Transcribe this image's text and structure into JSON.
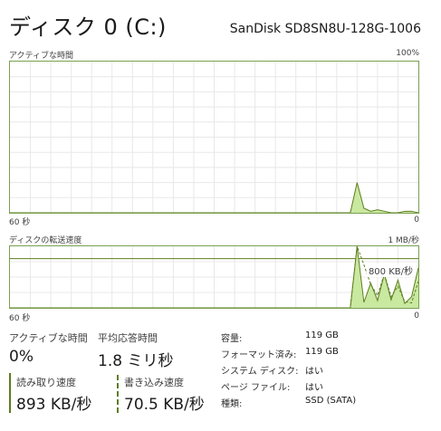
{
  "header": {
    "title": "ディスク 0 (C:)",
    "model": "SanDisk SD8SN8U-128G-1006"
  },
  "activity_graph": {
    "label": "アクティブな時間",
    "max_label": "100%",
    "time_label": "60 秒",
    "zero_label": "0"
  },
  "transfer_graph": {
    "label": "ディスクの転送速度",
    "max_label": "1 MB/秒",
    "line_label": "800 KB/秒",
    "time_label": "60 秒",
    "zero_label": "0"
  },
  "stats": {
    "active_time_label": "アクティブな時間",
    "active_time_value": "0%",
    "response_label": "平均応答時間",
    "response_value": "1.8 ミリ秒",
    "read_label": "読み取り速度",
    "read_value": "893 KB/秒",
    "write_label": "書き込み速度",
    "write_value": "70.5 KB/秒"
  },
  "info": [
    {
      "key": "容量:",
      "value": "119 GB"
    },
    {
      "key": "フォーマット済み:",
      "value": "119 GB"
    },
    {
      "key": "システム ディスク:",
      "value": "はい"
    },
    {
      "key": "ページ ファイル:",
      "value": "はい"
    },
    {
      "key": "種類:",
      "value": "SSD (SATA)"
    }
  ],
  "colors": {
    "accent": "#78a050",
    "fill": "#c9e8a0",
    "line": "#5e7d1e",
    "grid": "#e8e8e8"
  },
  "chart_data": [
    {
      "type": "area",
      "title": "アクティブな時間",
      "x": [
        60,
        50,
        40,
        30,
        20,
        10,
        9,
        8,
        7,
        6,
        5,
        4,
        3,
        2,
        1,
        0
      ],
      "series": [
        {
          "values": [
            0,
            0,
            0,
            0,
            0,
            0,
            20,
            3,
            1,
            2,
            1,
            0,
            0,
            1,
            1,
            0
          ]
        }
      ],
      "ylim": [
        0,
        100
      ],
      "grid": true
    },
    {
      "type": "area",
      "title": "ディスクの転送速度",
      "x": [
        60,
        50,
        40,
        30,
        20,
        10,
        9,
        8,
        7,
        6,
        5,
        4,
        3,
        2,
        1,
        0
      ],
      "series": [
        {
          "values": [
            0,
            0,
            0,
            0,
            0,
            0,
            1000,
            90,
            400,
            120,
            550,
            130,
            450,
            70,
            180,
            650
          ]
        },
        {
          "values": [
            0,
            0,
            0,
            0,
            0,
            0,
            1000,
            700,
            380,
            200,
            550,
            180,
            350,
            100,
            80,
            430
          ]
        }
      ],
      "ylim": [
        0,
        1000
      ],
      "reference_line": 800,
      "grid": true
    }
  ]
}
